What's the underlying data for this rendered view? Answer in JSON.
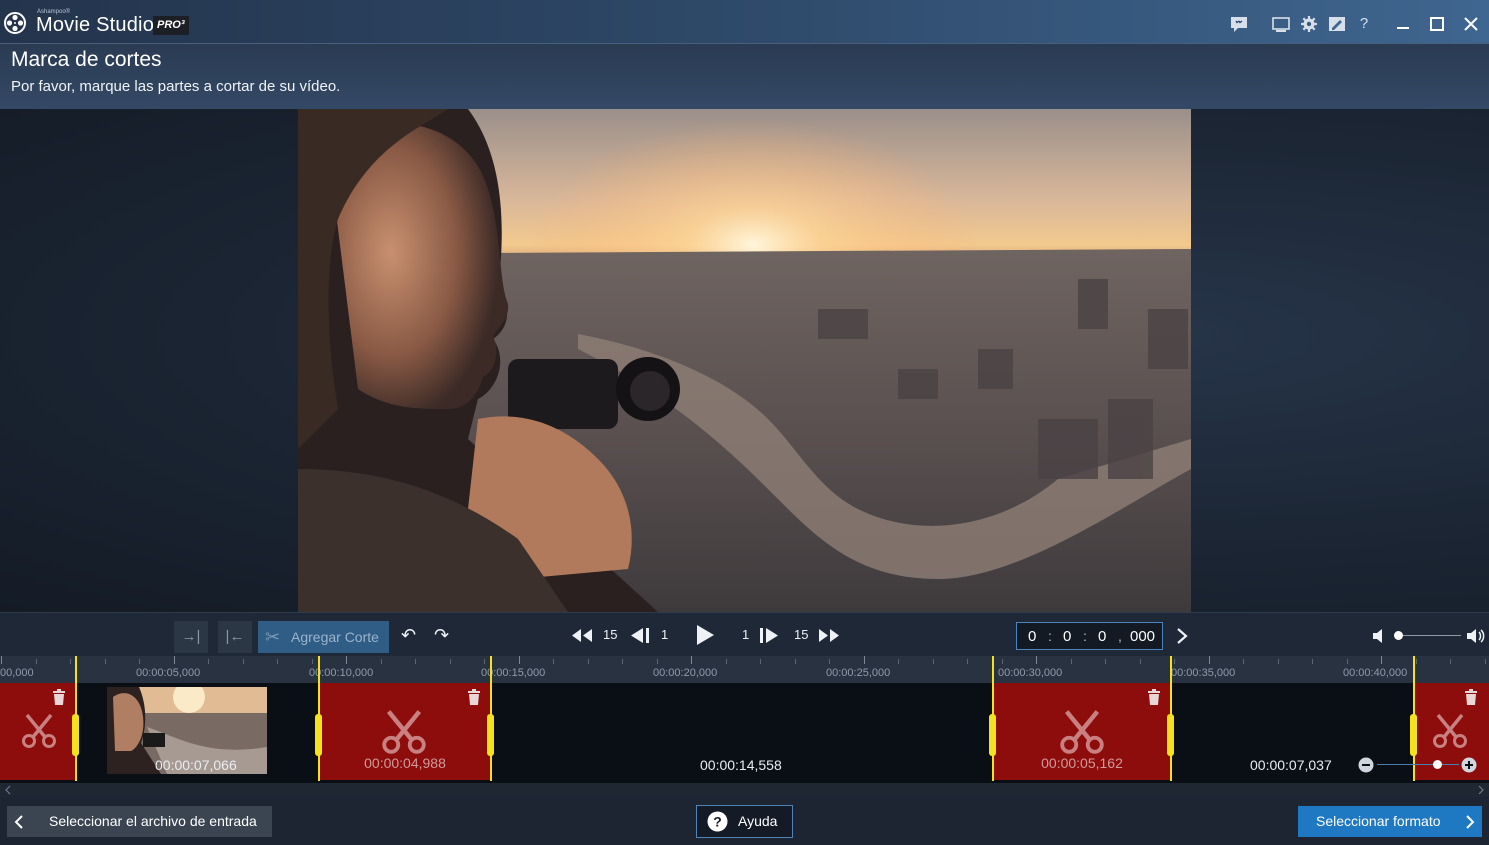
{
  "app": {
    "brand_small": "Ashampoo®",
    "title": "Movie Studio",
    "edition": "PRO³"
  },
  "titlebar_icons": [
    "feedback-icon",
    "screen-icon",
    "settings-icon",
    "edit-icon",
    "help-icon",
    "minimize-icon",
    "maximize-icon",
    "close-icon"
  ],
  "header": {
    "title": "Marca de cortes",
    "subtitle": "Por favor, marque las partes a cortar de su vídeo."
  },
  "controls": {
    "add_cut_label": "Agregar Corte",
    "step_back_large": "15",
    "step_back_small": "1",
    "step_forward_small": "1",
    "step_forward_large": "15",
    "timecode": {
      "hours": "0",
      "minutes": "0",
      "seconds": "0",
      "millis": "000"
    },
    "volume_level": 0
  },
  "timeline": {
    "ticks": [
      "00,000",
      "00:00:05,000",
      "00:00:10,000",
      "00:00:15,000",
      "00:00:20,000",
      "00:00:25,000",
      "00:00:30,000",
      "00:00:35,000",
      "00:00:40,000"
    ],
    "cuts": [
      "",
      "00:00:04,988",
      "00:00:05,162",
      ""
    ],
    "clips": [
      "00:00:07,066",
      "00:00:14,558",
      "00:00:07,037"
    ]
  },
  "footer": {
    "back_label": "Seleccionar el archivo de entrada",
    "help_label": "Ayuda",
    "next_label": "Seleccionar formato"
  },
  "colors": {
    "accent": "#1e78c2",
    "cut_red": "#8d0c0c",
    "marker_yellow": "#f3e21d"
  }
}
